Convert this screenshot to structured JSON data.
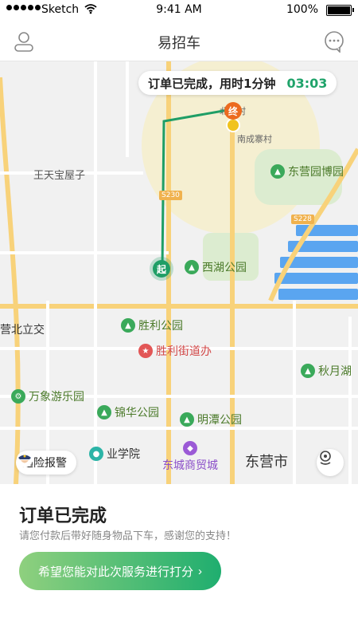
{
  "status_bar": {
    "carrier": "Sketch",
    "time": "9:41 AM",
    "battery": "100%"
  },
  "nav": {
    "title": "易招车"
  },
  "trip_banner": {
    "text": "订单已完成，用时1分钟",
    "duration": "03:03"
  },
  "map": {
    "pins": {
      "start": "起",
      "end": "终"
    },
    "pois": [
      {
        "label": "东营园博园",
        "style": "green"
      },
      {
        "label": "西湖公园",
        "style": "green"
      },
      {
        "label": "胜利公园",
        "style": "green"
      },
      {
        "label": "胜利街道办",
        "style": "red"
      },
      {
        "label": "秋月湖",
        "style": "green"
      },
      {
        "label": "万象游乐园",
        "style": "green"
      },
      {
        "label": "锦华公园",
        "style": "green"
      },
      {
        "label": "明潭公园",
        "style": "green"
      },
      {
        "label": "东城商贸城",
        "style": "purple"
      },
      {
        "label": "业学院",
        "style": "teal"
      }
    ],
    "places": {
      "village1": "北寨村",
      "village2": "南成寨村",
      "village3": "王天宝屋子",
      "interchange": "营北立交",
      "city": "东营市"
    },
    "road_signs": [
      "S230",
      "S228"
    ]
  },
  "alarm_button": {
    "label": "遇险报警"
  },
  "sheet": {
    "title": "订单已完成",
    "subtitle": "请您付款后带好随身物品下车，感谢您的支持！",
    "rate_button": "希望您能对此次服务进行打分",
    "rate_chevron": "›"
  },
  "colors": {
    "accent": "#1fa36a",
    "route": "#1f9e66",
    "end_pin": "#ec6a1f"
  }
}
